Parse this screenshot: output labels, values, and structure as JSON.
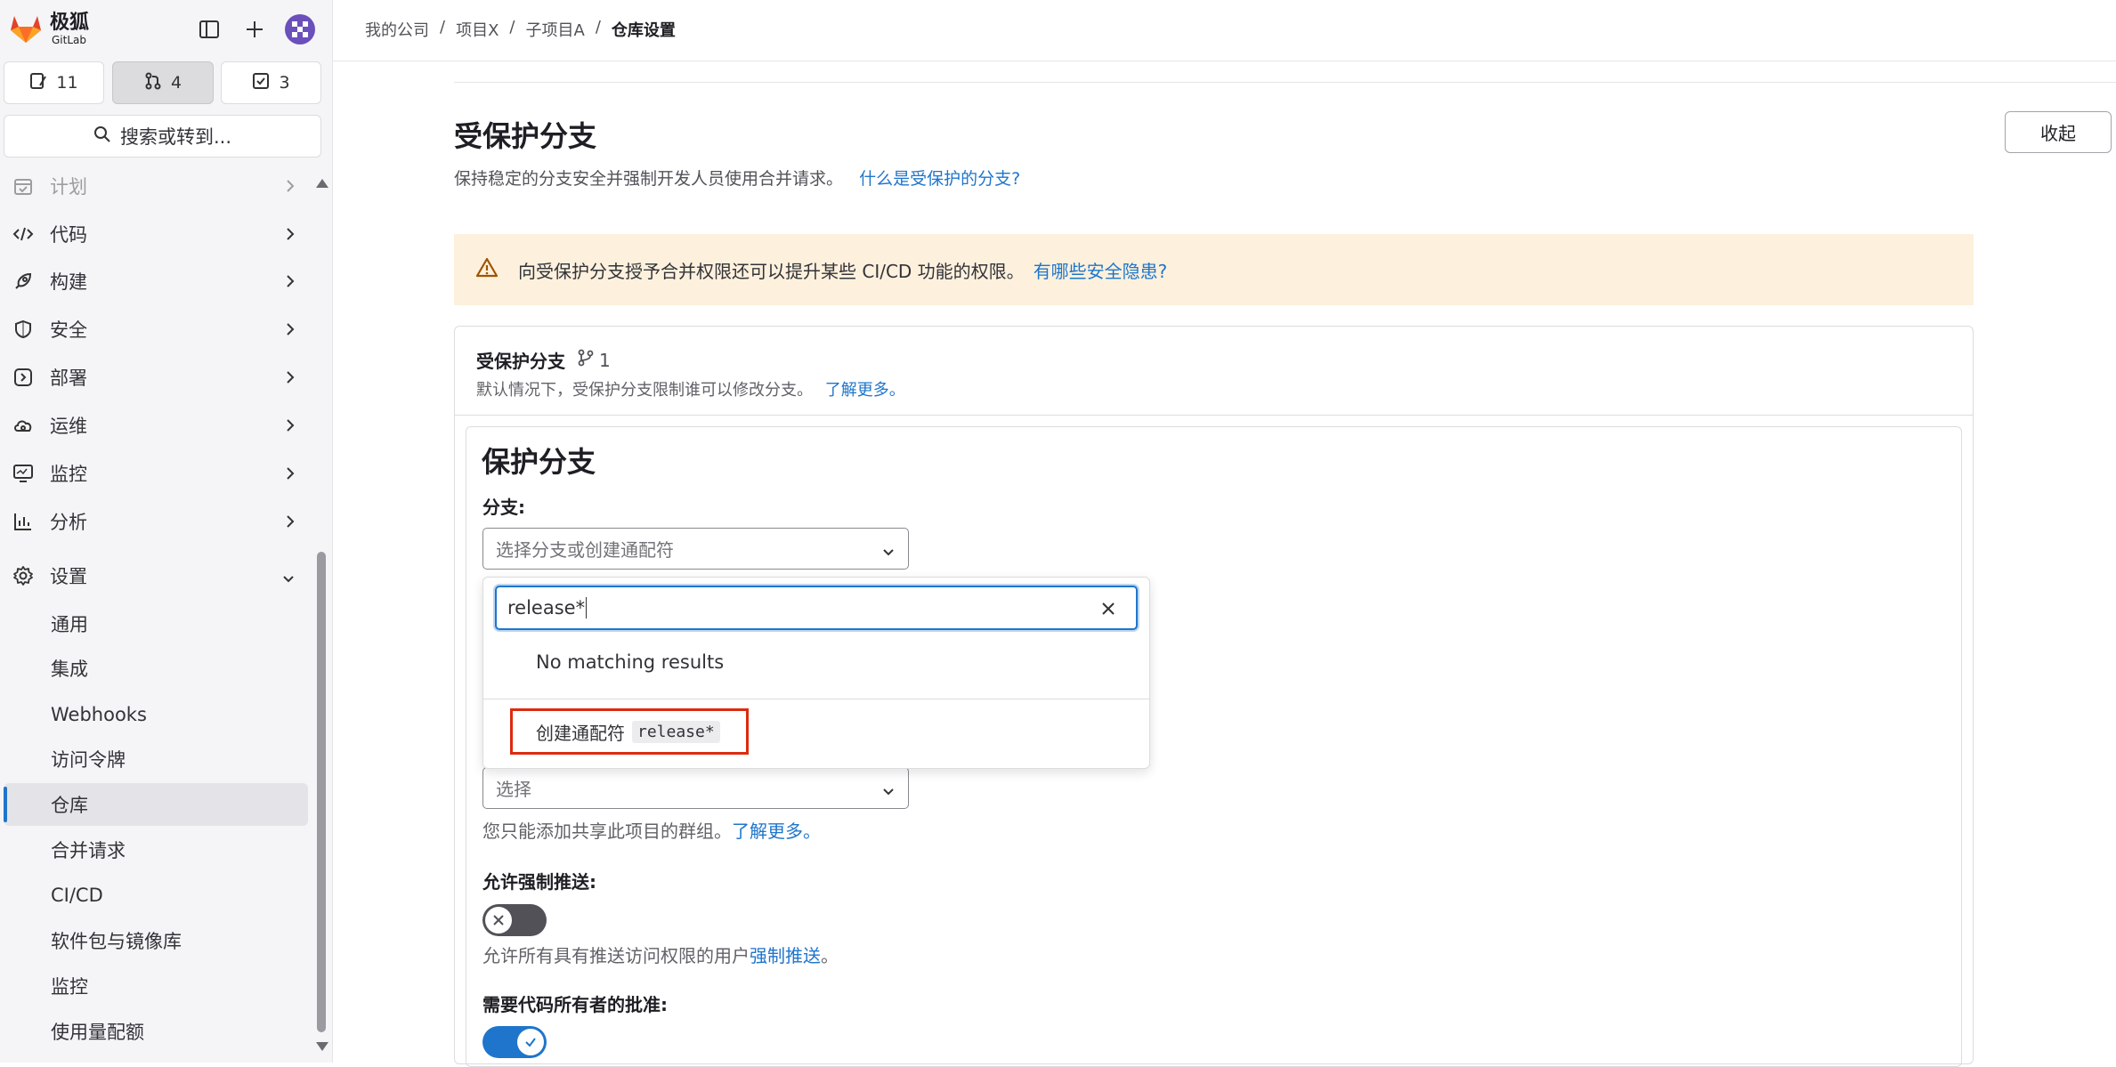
{
  "app": {
    "name": "极狐",
    "sub": "GitLab",
    "counters": [
      {
        "icon": "issues-icon",
        "value": "11"
      },
      {
        "icon": "merge-request-icon",
        "value": "4"
      },
      {
        "icon": "todo-icon",
        "value": "3"
      }
    ],
    "search_label": "搜索或转到..."
  },
  "sidebar": {
    "items": [
      {
        "label": "计划"
      },
      {
        "label": "代码"
      },
      {
        "label": "构建"
      },
      {
        "label": "安全"
      },
      {
        "label": "部署"
      },
      {
        "label": "运维"
      },
      {
        "label": "监控"
      },
      {
        "label": "分析"
      },
      {
        "label": "设置"
      }
    ],
    "settings_sub": [
      {
        "label": "通用"
      },
      {
        "label": "集成"
      },
      {
        "label": "Webhooks"
      },
      {
        "label": "访问令牌"
      },
      {
        "label": "仓库"
      },
      {
        "label": "合并请求"
      },
      {
        "label": "CI/CD"
      },
      {
        "label": "软件包与镜像库"
      },
      {
        "label": "监控"
      },
      {
        "label": "使用量配额"
      }
    ]
  },
  "breadcrumb": {
    "items": [
      "我的公司",
      "项目X",
      "子项目A",
      "仓库设置"
    ],
    "separator": "/"
  },
  "section": {
    "title": "受保护分支",
    "desc": "保持稳定的分支安全并强制开发人员使用合并请求。",
    "desc_link": "什么是受保护的分支?",
    "collapse_label": "收起"
  },
  "alert": {
    "text": "向受保护分支授予合并权限还可以提升某些 CI/CD 功能的权限。",
    "link": "有哪些安全隐患?"
  },
  "card": {
    "title": "受保护分支",
    "count": "1",
    "desc": "默认情况下，受保护分支限制谁可以修改分支。",
    "desc_link": "了解更多。"
  },
  "form": {
    "title": "保护分支",
    "branch_label": "分支:",
    "branch_placeholder": "选择分支或创建通配符",
    "search_value": "release*",
    "no_results": "No matching results",
    "create_label": "创建通配符",
    "create_code": "release*",
    "select_placeholder": "选择",
    "group_help": "您只能添加共享此项目的群组。",
    "group_help_link": "了解更多。",
    "force_push_label": "允许强制推送:",
    "force_push_help": "允许所有具有推送访问权限的用户",
    "force_push_link": "强制推送",
    "force_push_end": "。",
    "codeowner_label": "需要代码所有者的批准:",
    "force_push_enabled": false,
    "codeowner_enabled": true
  },
  "colors": {
    "accent": "#1f75cb",
    "alert_bg": "#fdf1dd",
    "highlight_border": "#dd2b0e"
  }
}
